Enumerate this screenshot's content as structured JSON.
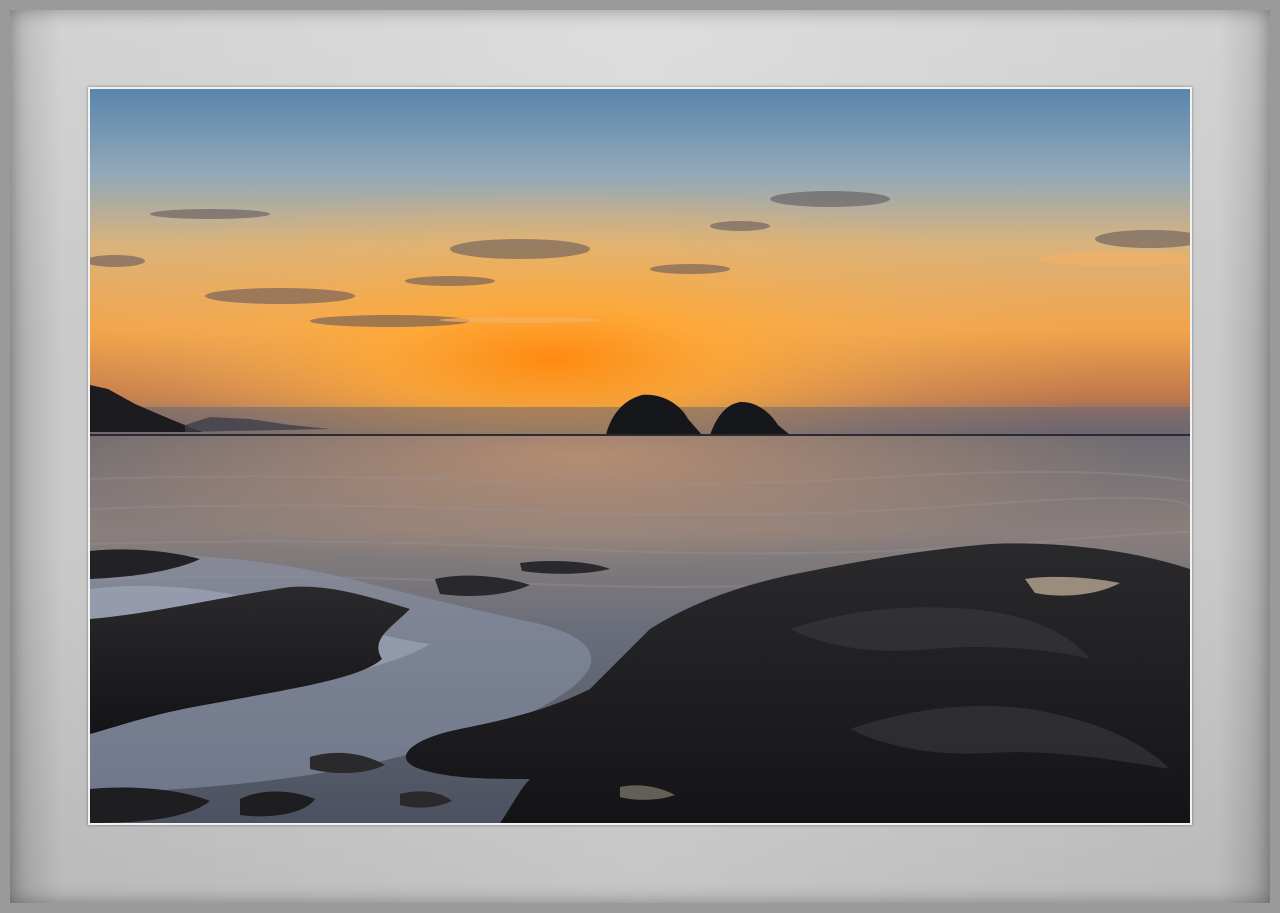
{
  "photo": {
    "subject": "sunset-seascape",
    "colors": {
      "sky_top": "#5b86ae",
      "sky_mid": "#e6b06a",
      "sun_glow": "#ff9a1e",
      "horizon": "#6e6a76",
      "sea": "#5f6572",
      "rock": "#1d1c1f"
    }
  }
}
